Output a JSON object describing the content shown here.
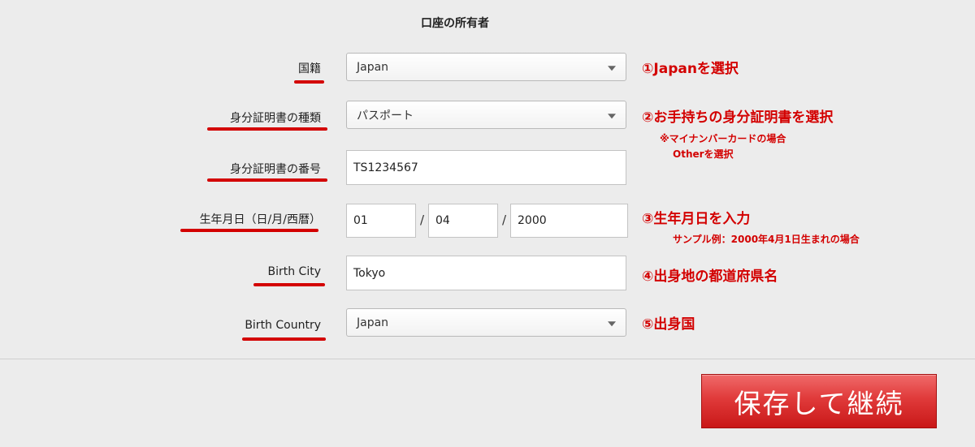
{
  "section_title": "口座の所有者",
  "fields": {
    "nationality": {
      "label": "国籍",
      "value": "Japan"
    },
    "id_type": {
      "label": "身分証明書の種類",
      "value": "パスポート"
    },
    "id_number": {
      "label": "身分証明書の番号",
      "value": "TS1234567"
    },
    "birth_date": {
      "label": "生年月日（日/月/西暦）",
      "day": "01",
      "month": "04",
      "year": "2000",
      "separator": "/"
    },
    "birth_city": {
      "label": "Birth City",
      "value": "Tokyo"
    },
    "birth_country": {
      "label": "Birth Country",
      "value": "Japan"
    }
  },
  "annotations": {
    "a1": "①Japanを選択",
    "a2": "②お手持ちの身分証明書を選択",
    "a2_note1": "※マイナンバーカードの場合",
    "a2_note2": "Otherを選択",
    "a3": "③生年月日を入力",
    "a3_note": "サンプル例：2000年4月1日生まれの場合",
    "a4": "④出身地の都道府県名",
    "a5": "⑤出身国"
  },
  "save_button": {
    "label": "保存して継続"
  },
  "colors": {
    "accent_red": "#d30000",
    "button_red": "#e03a3a",
    "background": "#ececec"
  },
  "icons": {
    "dropdown": "chevron-down-icon"
  }
}
